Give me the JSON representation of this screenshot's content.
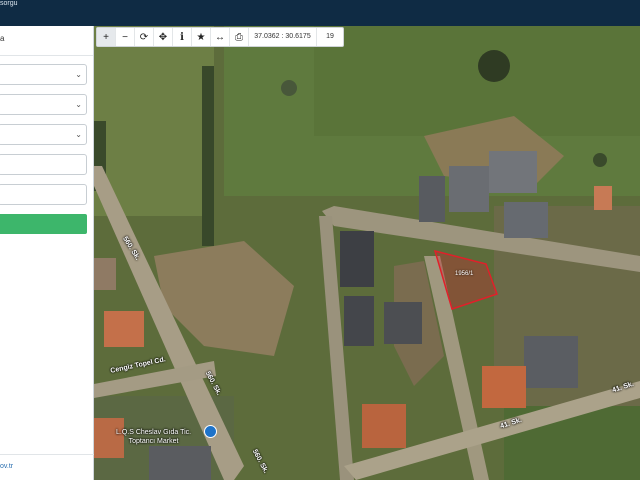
{
  "app": {
    "brand_fragment": "sorgu"
  },
  "sidebar": {
    "header_fragment": "a",
    "query_button": "",
    "footer_link": "ov.tr"
  },
  "toolbar": {
    "coordinates": "37.0362 : 30.6175",
    "zoom_level": "19",
    "tools": [
      "zoom-in",
      "zoom-out",
      "refresh",
      "locate",
      "info",
      "favorite",
      "measure",
      "print"
    ]
  },
  "map": {
    "parcel_label": "1956/1",
    "streets": [
      "560. Sk.",
      "560. Sk.",
      "560. Sk.",
      "Cengiz Topel Cd.",
      "41. Sk.",
      "41. Sk."
    ],
    "poi": {
      "name": "L.Q.S Cheslav Gıda Tic.",
      "category": "Toptancı Market"
    }
  },
  "colors": {
    "parcel_outline": "#e0202a",
    "query_button": "#3db66b",
    "topbar": "#0f2b44"
  }
}
